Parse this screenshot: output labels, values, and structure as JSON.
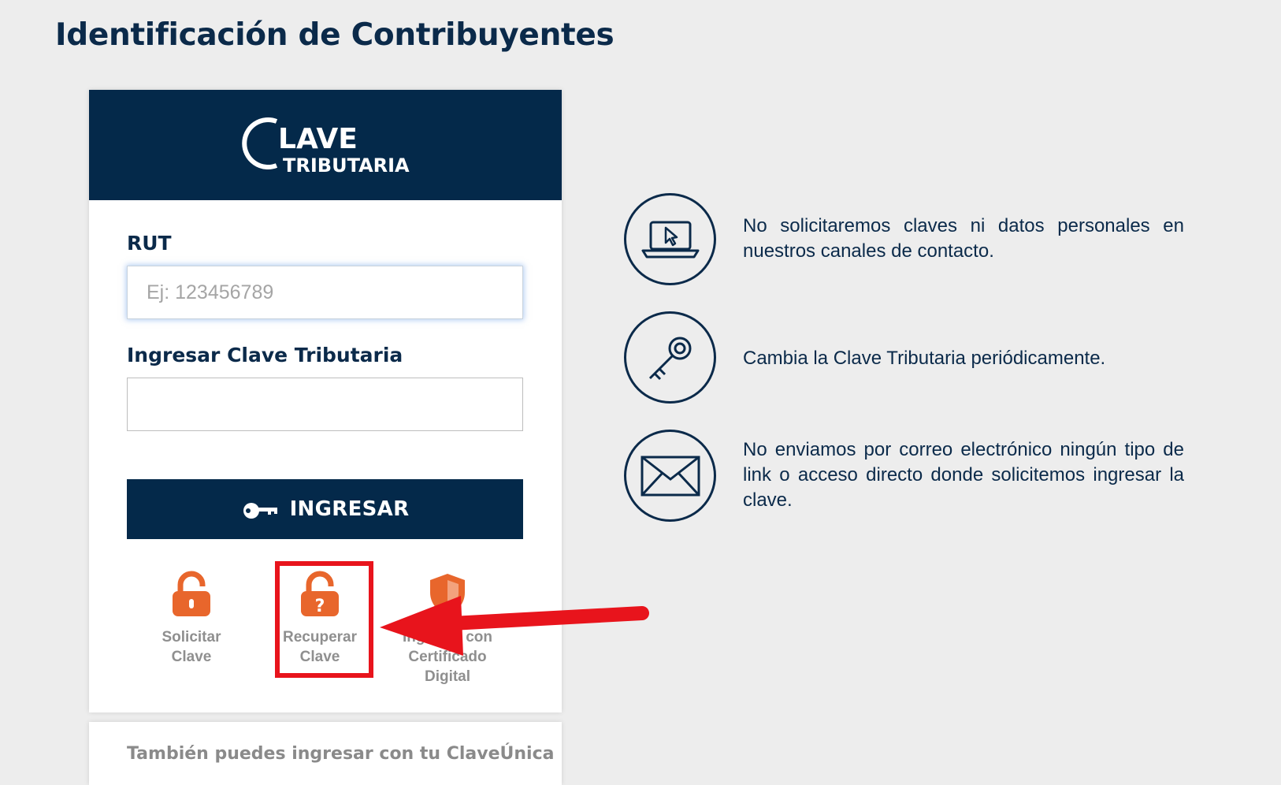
{
  "page": {
    "title": "Identificación de Contribuyentes"
  },
  "brand": {
    "logo_line1": "LAVE",
    "logo_line2": "TRIBUTARIA",
    "header_color": "#04294a"
  },
  "form": {
    "rut_label": "RUT",
    "rut_placeholder": "Ej: 123456789",
    "rut_value": "",
    "password_label": "Ingresar Clave Tributaria",
    "password_value": "",
    "submit_label": "INGRESAR",
    "submit_icon": "key-icon"
  },
  "options": [
    {
      "label": "Solicitar\nClave",
      "icon": "unlock-icon"
    },
    {
      "label": "Recuperar\nClave",
      "icon": "lock-question-icon",
      "highlighted": true
    },
    {
      "label": "Ingresar con\nCertificado\nDigital",
      "icon": "shield-icon"
    }
  ],
  "claveunica": {
    "text": "También puedes ingresar con tu ClaveÚnica"
  },
  "tips": [
    {
      "icon": "laptop-cursor-icon",
      "text": "No solicitaremos claves ni datos personales en nuestros canales de contacto."
    },
    {
      "icon": "key-icon",
      "text": "Cambia la Clave Tributaria periódicamente."
    },
    {
      "icon": "envelope-icon",
      "text": "No enviamos por correo electrónico ningún tipo de link o acceso directo donde solicitemos ingresar la clave."
    }
  ],
  "colors": {
    "navy": "#04294a",
    "accent_orange": "#e8662c",
    "annotation_red": "#e8141c",
    "background": "#ededed"
  }
}
